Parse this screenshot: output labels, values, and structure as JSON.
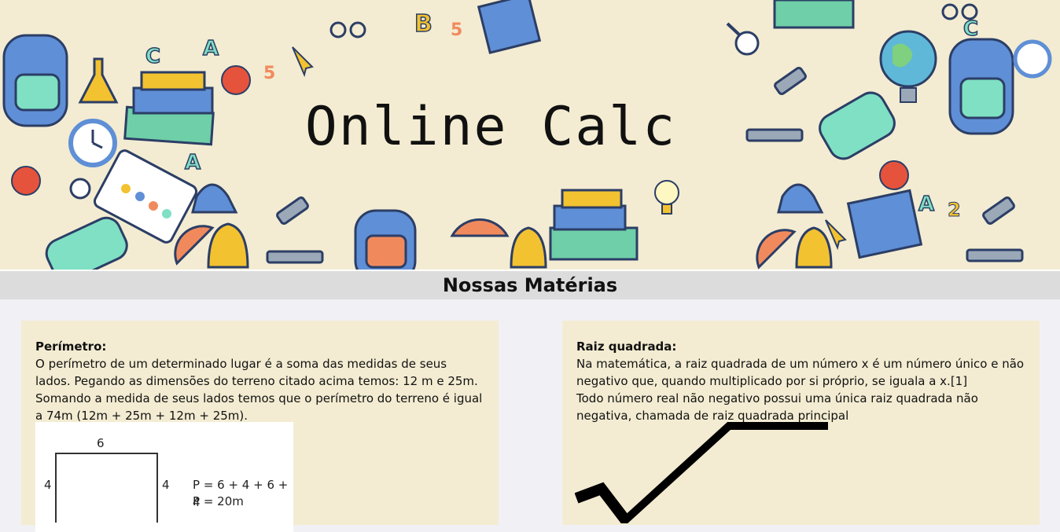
{
  "banner": {
    "title": "Online Calc"
  },
  "section": {
    "heading": "Nossas Matérias"
  },
  "cards": [
    {
      "title": "Perímetro:",
      "paragraphs": [
        "O perímetro de um determinado lugar é a soma das medidas de seus lados. Pegando as dimensões do terreno citado acima temos: 12 m e 25m. Somando a medida de seus lados temos que o perímetro do terreno é igual a 74m (12m + 25m + 12m + 25m)."
      ],
      "figure": {
        "top_label": "6",
        "left_label": "4",
        "right_label": "4",
        "formula_1": "P = 6 + 4 + 6 + 4",
        "formula_2": "P = 20m"
      }
    },
    {
      "title": "Raiz quadrada:",
      "paragraphs": [
        "Na matemática, a raiz quadrada de um número x é um número único e não negativo que, quando multiplicado por si próprio, se iguala a x.[1]",
        "Todo número real não negativo possui uma única raiz quadrada não negativa, chamada de raiz quadrada principal"
      ]
    }
  ],
  "colors": {
    "banner_bg": "#f3ecd2",
    "page_bg": "#f1f1f5",
    "section_bar": "#dcdcdc",
    "card_bg": "#f3ecd2"
  }
}
